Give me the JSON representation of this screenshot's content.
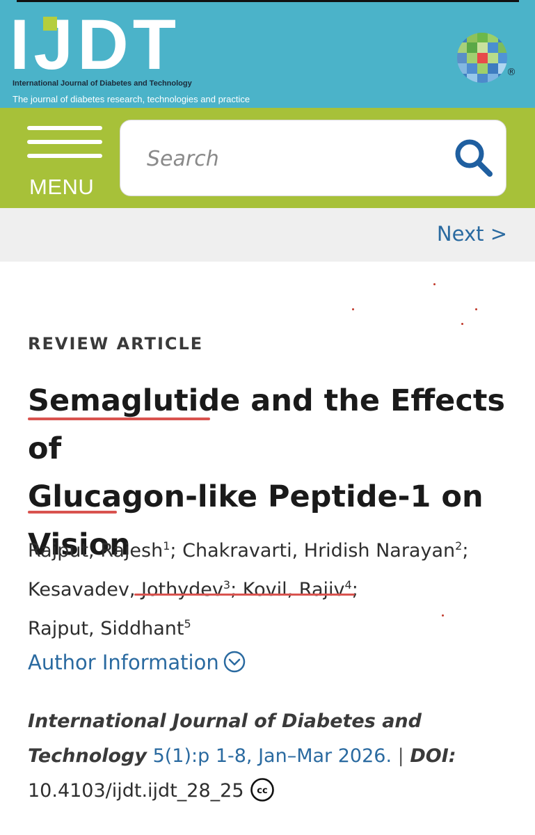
{
  "header": {
    "logo_text": "IJDT",
    "journal_name": "International Journal of Diabetes and Technology",
    "tagline": "The journal of diabetes research, technologies and practice",
    "registered_mark": "®",
    "colors": {
      "header_bg": "#4bb3c9",
      "nav_bg": "#a7c139",
      "accent_dot": "#b5ce3e"
    }
  },
  "nav": {
    "menu_label": "MENU",
    "menu_icon": "hamburger-icon",
    "search": {
      "placeholder": "Search",
      "icon": "search-icon"
    }
  },
  "pager": {
    "next_label": "Next >"
  },
  "article": {
    "type": "REVIEW ARTICLE",
    "title_line1_underlined": "Semaglutide",
    "title_line1_rest": " and the Effects of",
    "title_line2": "Glucagon-like Peptide-1 on",
    "title_line3_underlined": "Vision",
    "authors": [
      {
        "name": "Rajput, Rajesh",
        "sup": "1",
        "sep": "; "
      },
      {
        "name": "Chakravarti, Hridish Narayan",
        "sup": "2",
        "sep": "; "
      },
      {
        "name": "Kesavadev, Jothydev",
        "sup": "3",
        "sep": "; "
      },
      {
        "name": "Kovil, Rajiv",
        "sup": "4",
        "sep": ";"
      },
      {
        "name": "Rajput, Siddhant",
        "sup": "5",
        "sep": ""
      }
    ],
    "author_info_label": "Author Information",
    "citation": {
      "journal": "International Journal of Diabetes and Technology",
      "volume": "5(1):p 1-8, Jan–Mar 2026.",
      "separator": "|",
      "doi_label": "DOI:",
      "doi": "10.4103/ijdt.ijdt_28_25",
      "license_icon": "cc-icon"
    }
  }
}
